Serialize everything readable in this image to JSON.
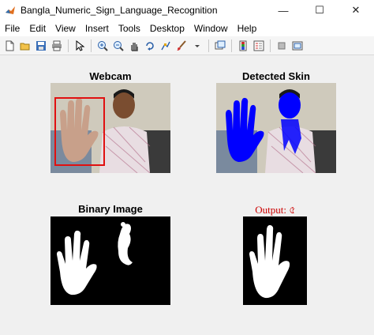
{
  "window": {
    "title": "Bangla_Numeric_Sign_Language_Recognition",
    "minimize_glyph": "—",
    "maximize_glyph": "☐",
    "close_glyph": "✕"
  },
  "menu": [
    "File",
    "Edit",
    "View",
    "Insert",
    "Tools",
    "Desktop",
    "Window",
    "Help"
  ],
  "toolbar": {
    "icons": [
      "new-figure-icon",
      "open-file-icon",
      "save-icon",
      "print-icon",
      "pointer-icon",
      "zoom-in-icon",
      "zoom-out-icon",
      "pan-icon",
      "rotate-3d-icon",
      "data-cursor-icon",
      "brush-icon",
      "insert-colorbar-icon",
      "insert-legend-icon",
      "hide-plot-tools-icon",
      "show-plot-tools-icon"
    ]
  },
  "axes": {
    "webcam": {
      "title": "Webcam"
    },
    "detected_skin": {
      "title": "Detected Skin"
    },
    "binary_image": {
      "title": "Binary Image"
    },
    "output": {
      "label": "Output:",
      "value": "৫"
    }
  },
  "colors": {
    "detection_box": "#e01010",
    "skin_overlay": "#0000ff",
    "output_text": "#cc0000"
  }
}
